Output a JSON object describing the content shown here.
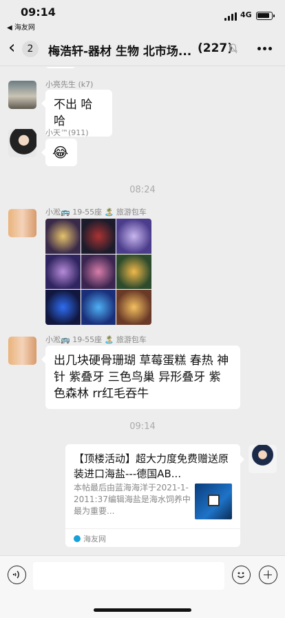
{
  "status": {
    "time": "09:14",
    "back_app": "◀ 海友网",
    "network": "4G"
  },
  "nav": {
    "unread": "2",
    "title": "梅浩轩-器材 生物 北市场...",
    "count": "(227)"
  },
  "messages": [
    {
      "name": "小亮先生 (k7)",
      "text": "不出 哈哈"
    },
    {
      "name": "小天™(911)",
      "text": "😂"
    },
    {
      "time": "08:24"
    },
    {
      "name": "小淞🚌 19-55座 🏝️ 旅游包车"
    },
    {
      "name": "小淞🚌 19-55座 🏝️ 旅游包车",
      "text": "出几块硬骨珊瑚 草莓蛋糕 春热 神针 紫叠牙 三色鸟巢 异形叠牙 紫色森林 rr红毛吞牛"
    },
    {
      "time": "09:14"
    }
  ],
  "card": {
    "title": "【顶楼活动】超大力度免费赠送原装进口海盐---德国AB...",
    "desc": "本帖最后由蓝海海洋于2021-1-2011:37编辑海盐是海水饲养中最为重要...",
    "source": "海友网"
  },
  "colors": {
    "background": "#ededed",
    "bubble": "#ffffff",
    "muted": "#888888"
  }
}
